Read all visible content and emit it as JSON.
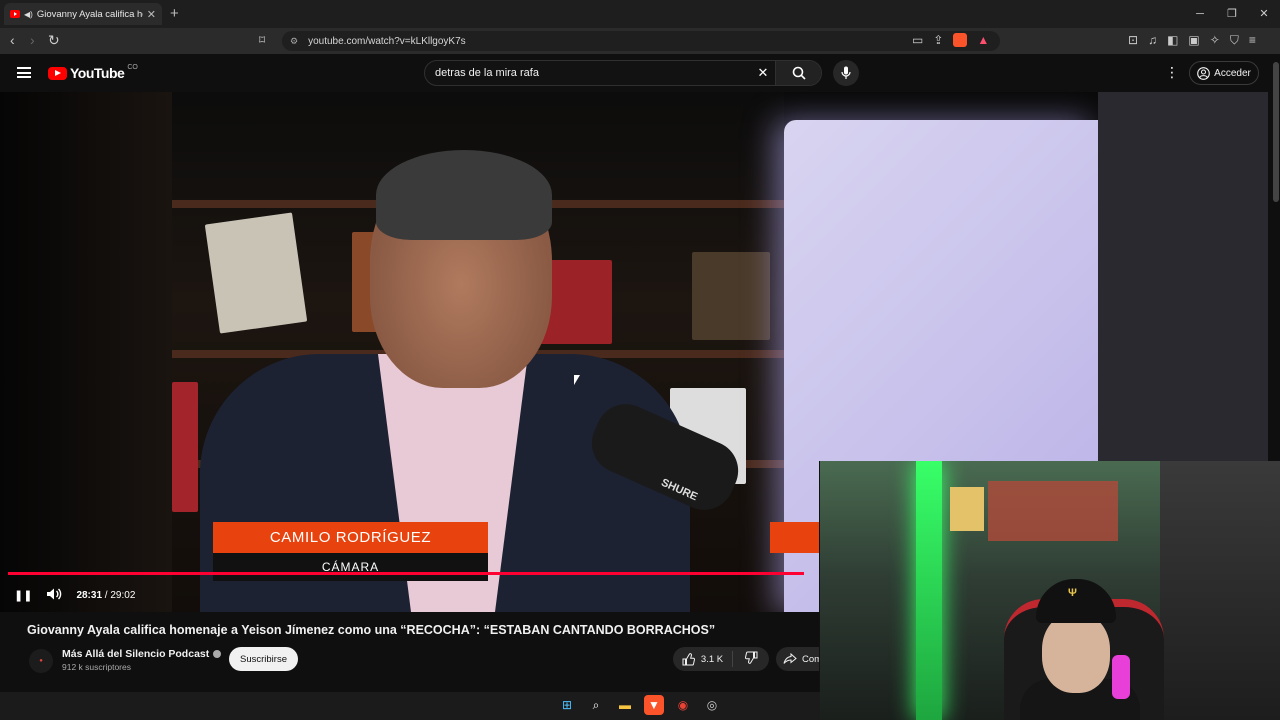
{
  "browser": {
    "tab_title": "Giovanny Ayala califica home",
    "tab_close": "✕",
    "new_tab": "+",
    "url": "youtube.com/watch?v=kLKllgoyK7s",
    "window_min": "─",
    "window_max": "❐",
    "window_close": "✕"
  },
  "youtube": {
    "logo_text": "YouTube",
    "country_code": "CO",
    "search_query": "detras de la mira rafa",
    "sign_in_label": "Acceder"
  },
  "video": {
    "lower_third_name": "CAMILO RODRÍGUEZ",
    "lower_third_role": "CÁMARA",
    "mic_brand": "SHURE",
    "current_time": "28:31",
    "time_separator": " / ",
    "duration": "29:02",
    "progress_fraction": 0.98,
    "title": "Giovanny Ayala califica homenaje a Yeison Jímenez como una “RECOCHA”: “ESTABAN CANTANDO BORRACHOS”"
  },
  "channel": {
    "name": "Más Allá del Silencio Podcast",
    "subscribers": "912 k suscriptores",
    "subscribe_label": "Suscribirse"
  },
  "actions": {
    "like_count": "3.1 K",
    "share_label": "Com"
  },
  "colors": {
    "accent_red": "#ff0000",
    "progress_red": "#ff0033",
    "lower_third_orange": "#e8430e"
  },
  "icons": {
    "back": "‹",
    "forward": "›",
    "reload": "↻",
    "bookmark": "⌑",
    "kebab": "⋮",
    "pause": "❚❚",
    "volume": "🔊",
    "like": "👍",
    "dislike": "👎",
    "share": "↪"
  }
}
